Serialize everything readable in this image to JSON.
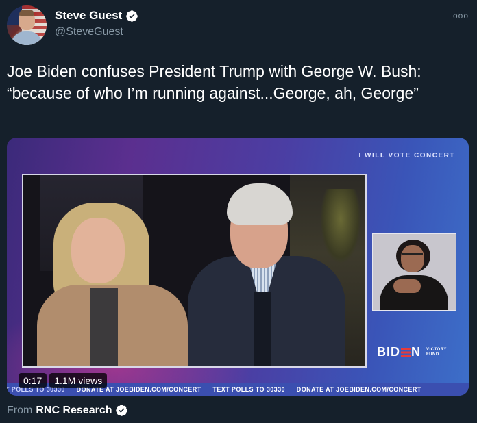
{
  "author": {
    "display_name": "Steve Guest",
    "handle": "@SteveGuest",
    "avatar": "profile-photo-flag-background",
    "verified_icon": "verified-badge-icon"
  },
  "more_icon": "more-options-icon",
  "more_glyph": "ooo",
  "tweet": {
    "text": "Joe Biden confuses President Trump with George W. Bush: “because of who I’m running against...George, ah, George”"
  },
  "media": {
    "overlay_title": "I WILL VOTE CONCERT",
    "logo": {
      "word_left": "BID",
      "word_right": "N",
      "sub_line1": "VICTORY",
      "sub_line2": "FUND"
    },
    "ticker": [
      "T POLLS TO 30330",
      "DONATE AT JOEBIDEN.COM/CONCERT",
      "TEXT POLLS TO 30330",
      "DONATE AT JOEBIDEN.COM/CONCERT"
    ],
    "time": "0:17",
    "views": "1.1M views"
  },
  "source": {
    "prefix": "From",
    "name": "RNC Research",
    "verified_icon": "verified-badge-icon"
  },
  "colors": {
    "background": "#15202b",
    "secondary_text": "#8899a6",
    "verified_fill": "#ffffff"
  }
}
